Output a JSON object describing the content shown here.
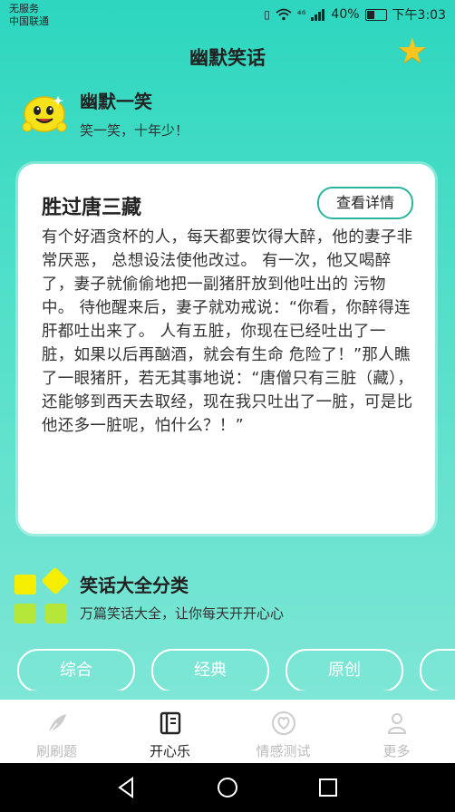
{
  "status_bar": {
    "carrier_line1": "无服务",
    "carrier_line2": "中国联通",
    "network": "⁴⁶",
    "battery": "40%",
    "time": "下午3:03"
  },
  "header": {
    "title": "幽默笑话"
  },
  "banner": {
    "title": "幽默一笑",
    "subtitle": "笑一笑，十年少！"
  },
  "card": {
    "title": "胜过唐三藏",
    "button": "查看详情",
    "body": "有个好酒贪杯的人，每天都要饮得大醉，他的妻子非常厌恶， 总想设法使他改过。 有一次，他又喝醉了，妻子就偷偷地把一副猪肝放到他吐出的 污物中。 待他醒来后，妻子就劝戒说：“你看，你醉得连肝都吐出来了。 人有五脏，你现在已经吐出了一脏，如果以后再酗酒，就会有生命 危险了！”那人瞧了一眼猪肝，若无其事地说：“唐僧只有三脏（藏）， 还能够到西天去取经，现在我只吐出了一脏，可是比他还多一脏呢，怕什么？！”"
  },
  "categories": {
    "title": "笑话大全分类",
    "subtitle": "万篇笑话大全，让你每天开开心心",
    "tags": [
      "综合",
      "经典",
      "原创",
      ""
    ]
  },
  "tabs": [
    {
      "label": "刷刷题",
      "icon": "feather-icon"
    },
    {
      "label": "开心乐",
      "icon": "book-icon"
    },
    {
      "label": "情感测试",
      "icon": "heart-icon"
    },
    {
      "label": "更多",
      "icon": "person-icon"
    }
  ],
  "colors": {
    "accent": "#2bb59e",
    "star": "#f8c61c",
    "yellow": "#f5ee00",
    "green": "#b5e63a"
  }
}
